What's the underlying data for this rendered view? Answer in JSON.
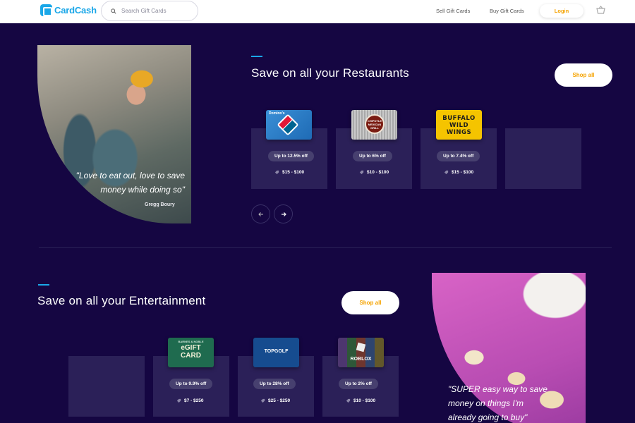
{
  "header": {
    "logo_text": "CardCash",
    "search_placeholder": "Search Gift Cards",
    "nav": [
      "Sell Gift Cards",
      "Buy Gift Cards"
    ],
    "login_label": "Login",
    "icons": {
      "search": "search-icon",
      "cart": "basket-icon"
    }
  },
  "restaurants": {
    "title": "Save on all your Restaurants",
    "shop_all": "Shop all",
    "quote": "\"Love to eat out, love to save money while doing so\"",
    "quote_line1": "\"Love to eat out, love to save",
    "quote_line2": "money while doing so\"",
    "author": "Gregg Boury",
    "cards": [
      {
        "brand": "Domino's",
        "discount": "Up to 12.5% off",
        "price": "$15 - $100"
      },
      {
        "brand": "Chipotle",
        "card_text": "CHIPOTLE MEXICAN GRILL",
        "discount": "Up to 6% off",
        "price": "$10 - $100"
      },
      {
        "brand": "Buffalo Wild Wings",
        "card_text": "BUFFALO WILD WINGS",
        "discount": "Up to 7.4% off",
        "price": "$15 - $100"
      }
    ]
  },
  "entertainment": {
    "title": "Save on all your Entertainment",
    "shop_all": "Shop all",
    "quote_line1": "\"SUPER easy way to save",
    "quote_line2": "money on things I'm",
    "quote_line3": "already going to buy\"",
    "cards": [
      {
        "brand": "Barnes & Noble",
        "card_text_top": "BARNES & NOBLE",
        "card_text_main": "eGIFT CARD",
        "discount": "Up to 9.9% off",
        "price": "$7 - $250"
      },
      {
        "brand": "Topgolf",
        "card_text": "TOPGOLF",
        "discount": "Up to 28% off",
        "price": "$25 - $250"
      },
      {
        "brand": "Roblox",
        "card_text": "ROBLOX",
        "discount": "Up to 2% off",
        "price": "$10 - $100"
      }
    ]
  },
  "colors": {
    "background": "#150642",
    "accent": "#1aa7e8",
    "cta_text": "#f5a300",
    "tile": "#2b2058"
  }
}
